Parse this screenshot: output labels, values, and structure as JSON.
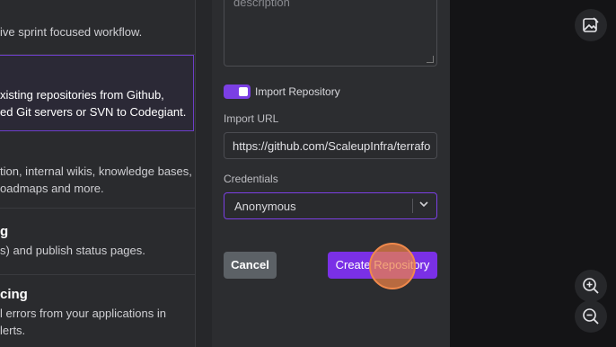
{
  "left_panel": {
    "items": [
      {
        "title": "",
        "lines": [
          "ive sprint focused workflow."
        ]
      },
      {
        "title": "",
        "lines": [
          "xisting repositories from Github,",
          "ed Git servers or SVN to Codegiant."
        ],
        "selected": true
      },
      {
        "title": "",
        "lines": [
          "tion, internal wikis, knowledge bases,",
          "oadmaps and more."
        ]
      },
      {
        "title": "g",
        "lines": [
          "s) and publish status pages."
        ]
      },
      {
        "title": "cing",
        "lines": [
          "l errors from your applications in",
          "lerts."
        ]
      }
    ]
  },
  "form": {
    "description_placeholder": "description",
    "import_toggle_label": "Import Repository",
    "import_toggle_on": true,
    "import_url_label": "Import URL",
    "import_url_value": "https://github.com/ScaleupInfra/terrafo",
    "credentials_label": "Credentials",
    "credentials_value": "Anonymous",
    "cancel_label": "Cancel",
    "create_label": "Create Repository"
  },
  "toolbar": {
    "icons": [
      "image-edit-icon",
      "zoom-in-icon",
      "zoom-out-icon"
    ]
  },
  "colors": {
    "accent": "#7a30e6",
    "click_marker": "#f0894c"
  }
}
